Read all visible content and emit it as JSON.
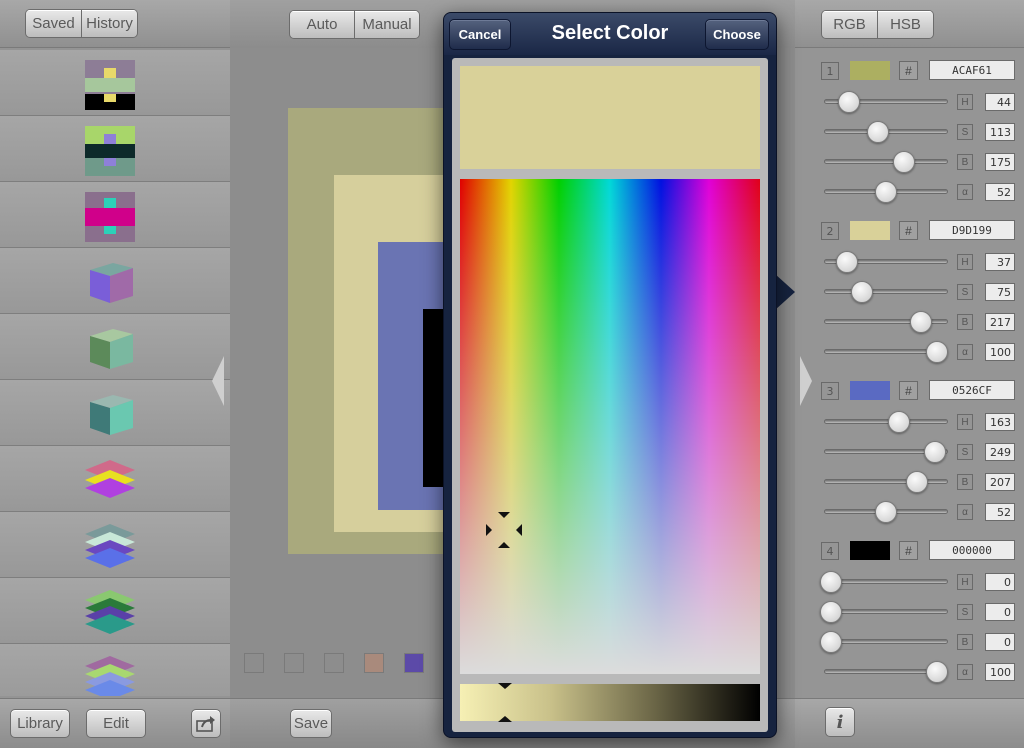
{
  "left": {
    "tabs": [
      "Saved",
      "History"
    ],
    "bottom": {
      "library": "Library",
      "edit": "Edit"
    }
  },
  "center": {
    "modes": [
      "Auto",
      "Manual"
    ],
    "save": "Save",
    "swatch_colors": [
      "#8e8e8e",
      "#8e8e8e",
      "#8e8e8e",
      "#a98a7c",
      "#5c4aa8"
    ]
  },
  "popover": {
    "title": "Select Color",
    "cancel": "Cancel",
    "choose": "Choose",
    "preview_color": "#D9D199"
  },
  "right": {
    "tabs": [
      "RGB",
      "HSB"
    ],
    "colors": [
      {
        "index": "1",
        "hex": "ACAF61",
        "swatch": "#ACAF61",
        "h": "44",
        "s": "113",
        "b": "175",
        "a": "52",
        "h_level": 0.17,
        "s_level": 0.44,
        "b_level": 0.69,
        "a_level": 0.52
      },
      {
        "index": "2",
        "hex": "D9D199",
        "swatch": "#D9D199",
        "h": "37",
        "s": "75",
        "b": "217",
        "a": "100",
        "h_level": 0.15,
        "s_level": 0.29,
        "b_level": 0.85,
        "a_level": 1.0
      },
      {
        "index": "3",
        "hex": "0526CF",
        "swatch": "#5a6ac2",
        "h": "163",
        "s": "249",
        "b": "207",
        "a": "52",
        "h_level": 0.64,
        "s_level": 0.98,
        "b_level": 0.81,
        "a_level": 0.52
      },
      {
        "index": "4",
        "hex": "000000",
        "swatch": "#000000",
        "h": "0",
        "s": "0",
        "b": "0",
        "a": "100",
        "h_level": 0.0,
        "s_level": 0.0,
        "b_level": 0.0,
        "a_level": 1.0
      }
    ],
    "slider_labels": [
      "H",
      "S",
      "B",
      "α"
    ]
  }
}
